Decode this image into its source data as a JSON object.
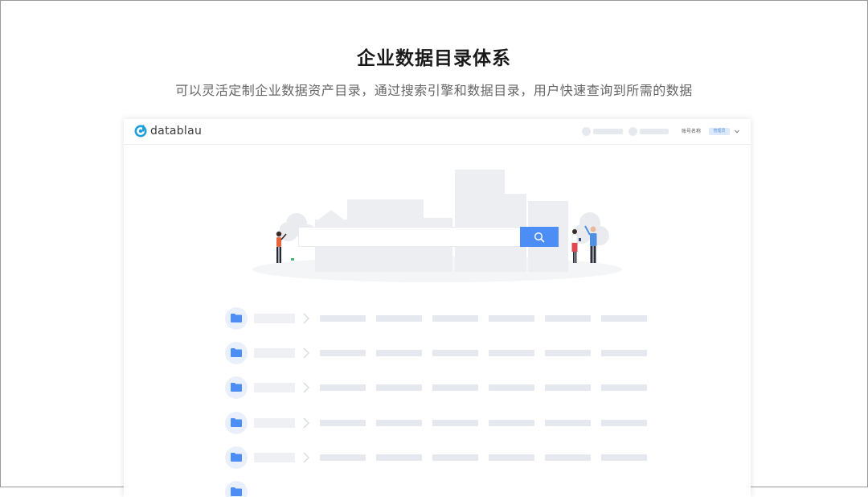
{
  "slide": {
    "title": "企业数据目录体系",
    "subtitle": "可以灵活定制企业数据资产目录，通过搜索引擎和数据目录，用户快速查询到所需的数据"
  },
  "app": {
    "logo_text": "datablau",
    "account_label": "账号名称",
    "role_badge": "管理员",
    "search": {
      "value": "",
      "placeholder": ""
    },
    "icons": {
      "logo": "datablau-logo-icon",
      "search": "search-icon",
      "dropdown": "chevron-down-icon",
      "folder": "folder-icon",
      "arrow": "chevron-right-icon"
    },
    "catalog_rows": 6,
    "colors": {
      "accent": "#4c8ef5",
      "logo": "#1fa0d8",
      "folder": "#4c8ef5",
      "skeleton": "#e5e8ee"
    }
  }
}
